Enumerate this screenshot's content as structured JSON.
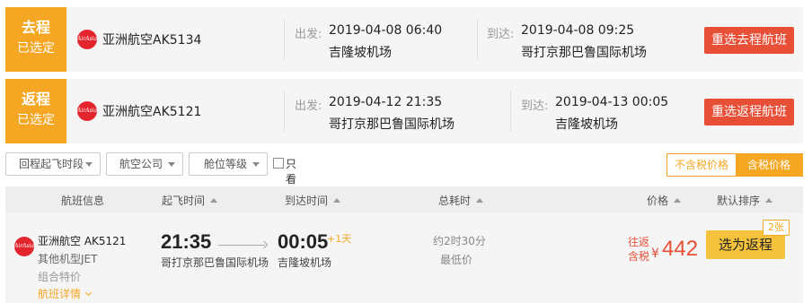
{
  "outbound": {
    "tag_line1": "去程",
    "tag_line2": "已选定",
    "logo_text": "AirAsia",
    "airline": "亚洲航空AK5134",
    "depart_label": "出发:",
    "depart_time": "2019-04-08 06:40",
    "depart_airport": "吉隆坡机场",
    "arrive_label": "到达:",
    "arrive_time": "2019-04-08 09:25",
    "arrive_airport": "哥打京那巴鲁国际机场",
    "reselect_button": "重选去程航班"
  },
  "return": {
    "tag_line1": "返程",
    "tag_line2": "已选定",
    "logo_text": "AirAsia",
    "airline": "亚洲航空AK5121",
    "depart_label": "出发:",
    "depart_time": "2019-04-12 21:35",
    "depart_airport": "哥打京那巴鲁国际机场",
    "arrive_label": "到达:",
    "arrive_time": "2019-04-13 00:05",
    "arrive_airport": "吉隆坡机场",
    "reselect_button": "重选返程航班"
  },
  "filters": {
    "return_departure_time": "回程起飞时段",
    "airline": "航空公司",
    "cabin_class": "舱位等级",
    "direct_only": "只看直飞",
    "direct_only_checked": false
  },
  "price_toggle": {
    "excluding_tax": "不含税价格",
    "including_tax": "含税价格",
    "selected": "含税价格"
  },
  "table_header": {
    "flight_info": "航班信息",
    "departure_time": "起飞时间",
    "arrival_time": "到达时间",
    "total_duration": "总耗时",
    "price": "价格",
    "default_sort": "默认排序"
  },
  "result": {
    "logo_text": "AirAsia",
    "airline": "亚洲航空 AK5121",
    "aircraft": "其他机型JET",
    "fare_type": "组合特价",
    "details_link": "航班详情",
    "depart_time": "21:35",
    "depart_airport": "哥打京那巴鲁国际机场",
    "arrive_time": "00:05",
    "next_day": "+1天",
    "arrive_airport": "吉隆坡机场",
    "duration": "约2时30分",
    "lowest_price": "最低价",
    "price_tag_1": "往返",
    "price_tag_2": "含税",
    "currency": "¥",
    "price": "442",
    "select_button": "选为返程",
    "tickets_left": "2张"
  },
  "colors": {
    "accent_orange": "#f5a623",
    "red_button": "#e84f37",
    "select_yellow": "#f5c33b",
    "airasia_red": "#e3262e"
  }
}
